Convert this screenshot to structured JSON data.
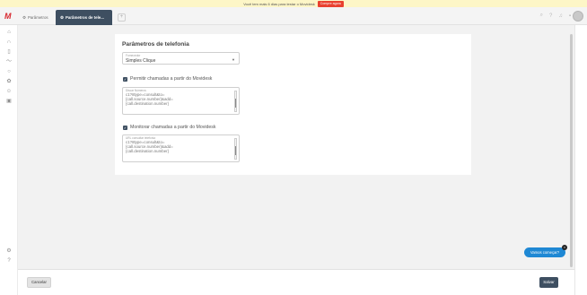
{
  "banner": {
    "text": "Você tem mais 6 dias para testar o Movidesk",
    "cta": "Compre agora"
  },
  "tabs": [
    {
      "label": "Parâmetros"
    },
    {
      "label": "Parâmetros de tele..."
    }
  ],
  "icons": {
    "logo": "M",
    "tab_add": "+",
    "top_search": "search-icon",
    "top_help": "help-icon",
    "top_bell": "bell-icon",
    "top_chat": "chat-icon"
  },
  "card": {
    "title": "Parâmetros de telefonia",
    "provider": {
      "label": "Fornecedor",
      "value": "Simples Clique"
    },
    "allow_calls": {
      "label": "Permitir chamadas a partir do Movidesk"
    },
    "call_url": {
      "label": "Discar Números",
      "value": "c1?8type=consult&to=\n{call.source.number}&add=\n{call.destination.number}"
    },
    "monitor_calls": {
      "label": "Monitorar chamadas a partir do Movidesk"
    },
    "monitor_url": {
      "label": "URL consultar telefonia",
      "value": "c1?8type=consult&to=\n{call.source.number}&add=\n{call.destination.number}"
    }
  },
  "footer": {
    "cancel": "Cancelar",
    "save": "Salvar"
  },
  "widget": {
    "label": "Vamos começar?",
    "close": "×"
  }
}
